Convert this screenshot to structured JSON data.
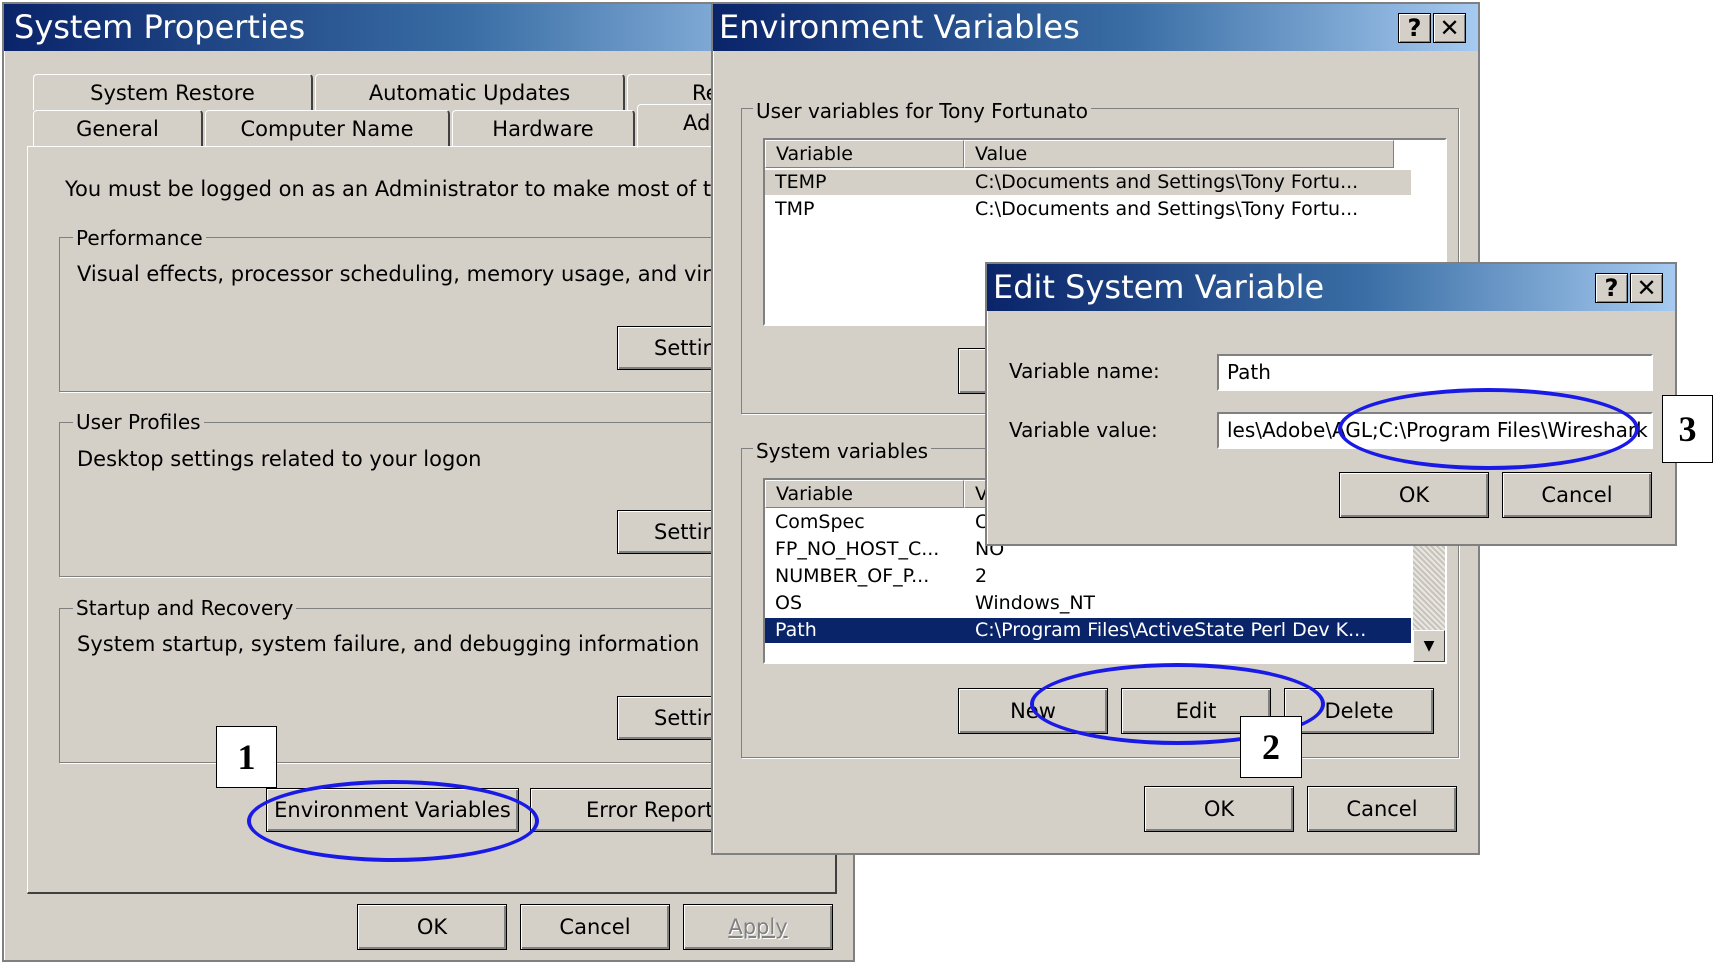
{
  "system_properties": {
    "title": "System Properties",
    "tabs_row1": [
      "System Restore",
      "Automatic Updates",
      "Re"
    ],
    "tabs_row2": [
      "General",
      "Computer Name",
      "Hardware",
      "Adv"
    ],
    "admin_note": "You must be logged on as an Administrator to make most of these ch",
    "performance": {
      "label": "Performance",
      "desc": "Visual effects, processor scheduling, memory usage, and virtual mer",
      "button": "Setting"
    },
    "user_profiles": {
      "label": "User Profiles",
      "desc": "Desktop settings related to your logon",
      "button": "Setting"
    },
    "startup": {
      "label": "Startup and Recovery",
      "desc": "System startup, system failure, and debugging information",
      "button": "Setting"
    },
    "env_button": "Environment Variables",
    "error_button": "Error Reportin",
    "ok": "OK",
    "cancel": "Cancel",
    "apply": "Apply"
  },
  "environment_variables": {
    "title": "Environment Variables",
    "help": "?",
    "close": "✕",
    "user_group_label": "User variables for Tony Fortunato",
    "columns": [
      "Variable",
      "Value"
    ],
    "user_rows": [
      {
        "variable": "TEMP",
        "value": "C:\\Documents and Settings\\Tony Fortu..."
      },
      {
        "variable": "TMP",
        "value": "C:\\Documents and Settings\\Tony Fortu..."
      }
    ],
    "system_group_label": "System variables",
    "system_columns": [
      "Variable",
      "V"
    ],
    "system_rows": [
      {
        "variable": "ComSpec",
        "value": "C"
      },
      {
        "variable": "FP_NO_HOST_C...",
        "value": "NO"
      },
      {
        "variable": "NUMBER_OF_P...",
        "value": "2"
      },
      {
        "variable": "OS",
        "value": "Windows_NT"
      },
      {
        "variable": "Path",
        "value": "C:\\Program Files\\ActiveState Perl Dev K..."
      }
    ],
    "new": "New",
    "edit": "Edit",
    "delete": "Delete",
    "ok": "OK",
    "cancel": "Cancel"
  },
  "edit_system_variable": {
    "title": "Edit System Variable",
    "help": "?",
    "close": "✕",
    "name_label": "Variable name:",
    "name_value": "Path",
    "value_label": "Variable value:",
    "value_value": "les\\Adobe\\AGL;C:\\Program Files\\Wireshark",
    "ok": "OK",
    "cancel": "Cancel"
  },
  "callouts": [
    "1",
    "2",
    "3"
  ],
  "colors": {
    "titlebar_start": "#0a246a",
    "titlebar_end": "#a6caf0",
    "face": "#d4d0c8",
    "selection": "#0a246a",
    "annotation": "#1a1ae6"
  }
}
